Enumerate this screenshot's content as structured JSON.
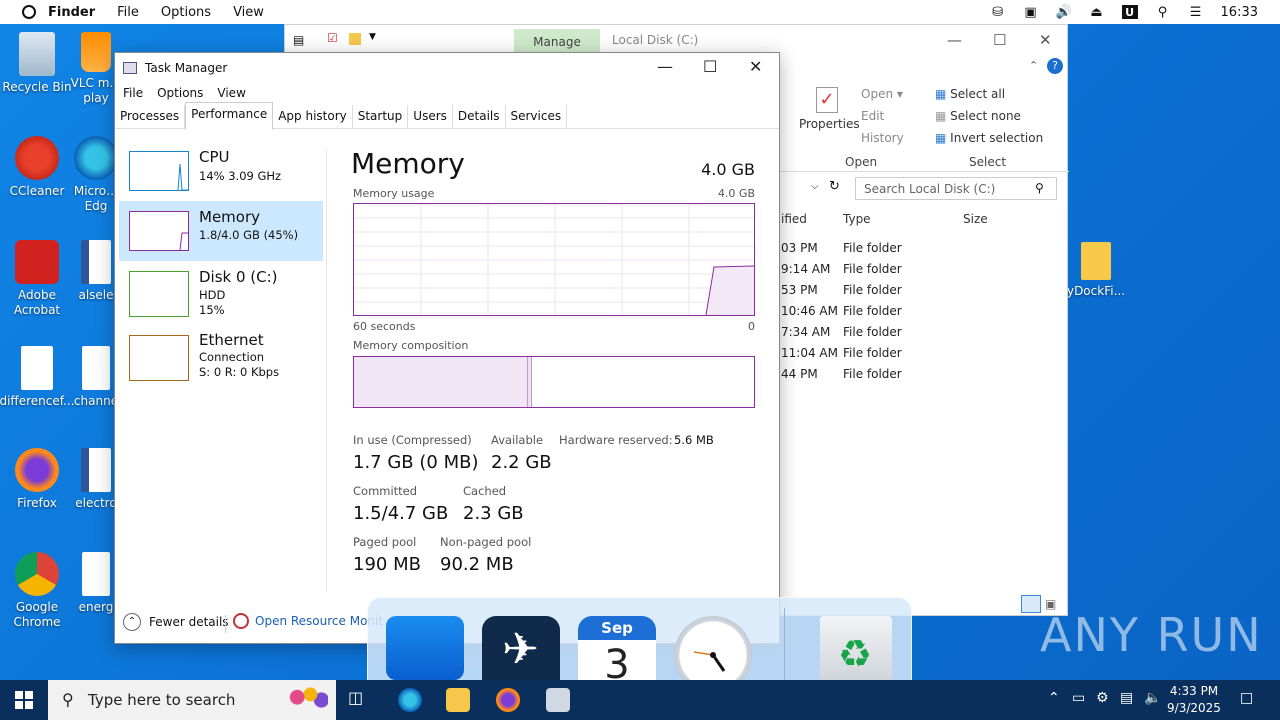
{
  "menubar": {
    "app": "Finder",
    "items": [
      "File",
      "Options",
      "View"
    ],
    "clock": "16:33"
  },
  "desktop": {
    "icons_left": [
      {
        "label": "Recycle Bin",
        "icon": "recycle-bin-icon"
      },
      {
        "label": "CCleaner",
        "icon": "ccleaner-icon"
      },
      {
        "label": "Adobe Acrobat",
        "icon": "acrobat-icon"
      },
      {
        "label": "differencef...",
        "icon": "image-file-icon"
      },
      {
        "label": "Firefox",
        "icon": "firefox-icon"
      },
      {
        "label": "Google Chrome",
        "icon": "chrome-icon"
      }
    ],
    "icons_second": [
      {
        "label": "VLC m… play",
        "icon": "vlc-icon"
      },
      {
        "label": "Micro… Edg",
        "icon": "edge-icon"
      },
      {
        "label": "alsele",
        "icon": "word-doc-icon"
      },
      {
        "label": "channe",
        "icon": "image-file-icon"
      },
      {
        "label": "electro",
        "icon": "word-doc-icon"
      },
      {
        "label": "energ",
        "icon": "image-file-icon"
      }
    ],
    "folder_right": {
      "label": "yDockFi..."
    }
  },
  "explorer": {
    "manage_tab": "Manage",
    "path_title": "Local Disk (C:)",
    "ribbon": {
      "open_group": {
        "properties": "Properties",
        "open": "Open",
        "edit": "Edit",
        "history": "History",
        "label": "Open"
      },
      "select_group": {
        "select_all": "Select all",
        "select_none": "Select none",
        "invert": "Invert selection",
        "label": "Select"
      }
    },
    "search_placeholder": "Search Local Disk (C:)",
    "columns": {
      "modified": "ified",
      "type": "Type",
      "size": "Size"
    },
    "rows": [
      {
        "time": "03 PM",
        "type": "File folder"
      },
      {
        "time": "9:14 AM",
        "type": "File folder"
      },
      {
        "time": "53 PM",
        "type": "File folder"
      },
      {
        "time": "10:46 AM",
        "type": "File folder"
      },
      {
        "time": "7:34 AM",
        "type": "File folder"
      },
      {
        "time": "11:04 AM",
        "type": "File folder"
      },
      {
        "time": "44 PM",
        "type": "File folder"
      }
    ]
  },
  "taskmanager": {
    "title": "Task Manager",
    "menu": [
      "File",
      "Options",
      "View"
    ],
    "tabs": [
      "Processes",
      "Performance",
      "App history",
      "Startup",
      "Users",
      "Details",
      "Services"
    ],
    "active_tab": "Performance",
    "sidebar": [
      {
        "name": "CPU",
        "l2": "14%  3.09 GHz",
        "l3": "",
        "color": "#1a85c8"
      },
      {
        "name": "Memory",
        "l2": "1.8/4.0 GB (45%)",
        "l3": "",
        "color": "#8b2ba0"
      },
      {
        "name": "Disk 0 (C:)",
        "l2": "HDD",
        "l3": "15%",
        "color": "#4aa02c"
      },
      {
        "name": "Ethernet",
        "l2": "Connection",
        "l3": "S: 0 R: 0 Kbps",
        "color": "#a5651c"
      }
    ],
    "memory": {
      "title": "Memory",
      "total": "4.0 GB",
      "usage_label": "Memory usage",
      "usage_max": "4.0 GB",
      "axis_left": "60 seconds",
      "axis_right": "0",
      "composition_label": "Memory composition",
      "stats": {
        "in_use_label": "In use (Compressed)",
        "in_use": "1.7 GB (0 MB)",
        "available_label": "Available",
        "available": "2.2 GB",
        "hw_reserved_label": "Hardware reserved:",
        "hw_reserved": "5.6 MB",
        "committed_label": "Committed",
        "committed": "1.5/4.7 GB",
        "cached_label": "Cached",
        "cached": "2.3 GB",
        "paged_label": "Paged pool",
        "paged": "190 MB",
        "nonpaged_label": "Non-paged pool",
        "nonpaged": "90.2 MB"
      }
    },
    "footer": {
      "fewer": "Fewer details",
      "resmon": "Open Resource Monit"
    }
  },
  "dock": {
    "calendar_month": "Sep",
    "calendar_day": "3"
  },
  "taskbar": {
    "search_placeholder": "Type here to search",
    "time": "4:33 PM",
    "date": "9/3/2025"
  },
  "watermark": "ANY RUN",
  "colors": {
    "memory_accent": "#8b2ba0",
    "selection": "#cce8ff",
    "desktop": "#0b6fd2"
  }
}
